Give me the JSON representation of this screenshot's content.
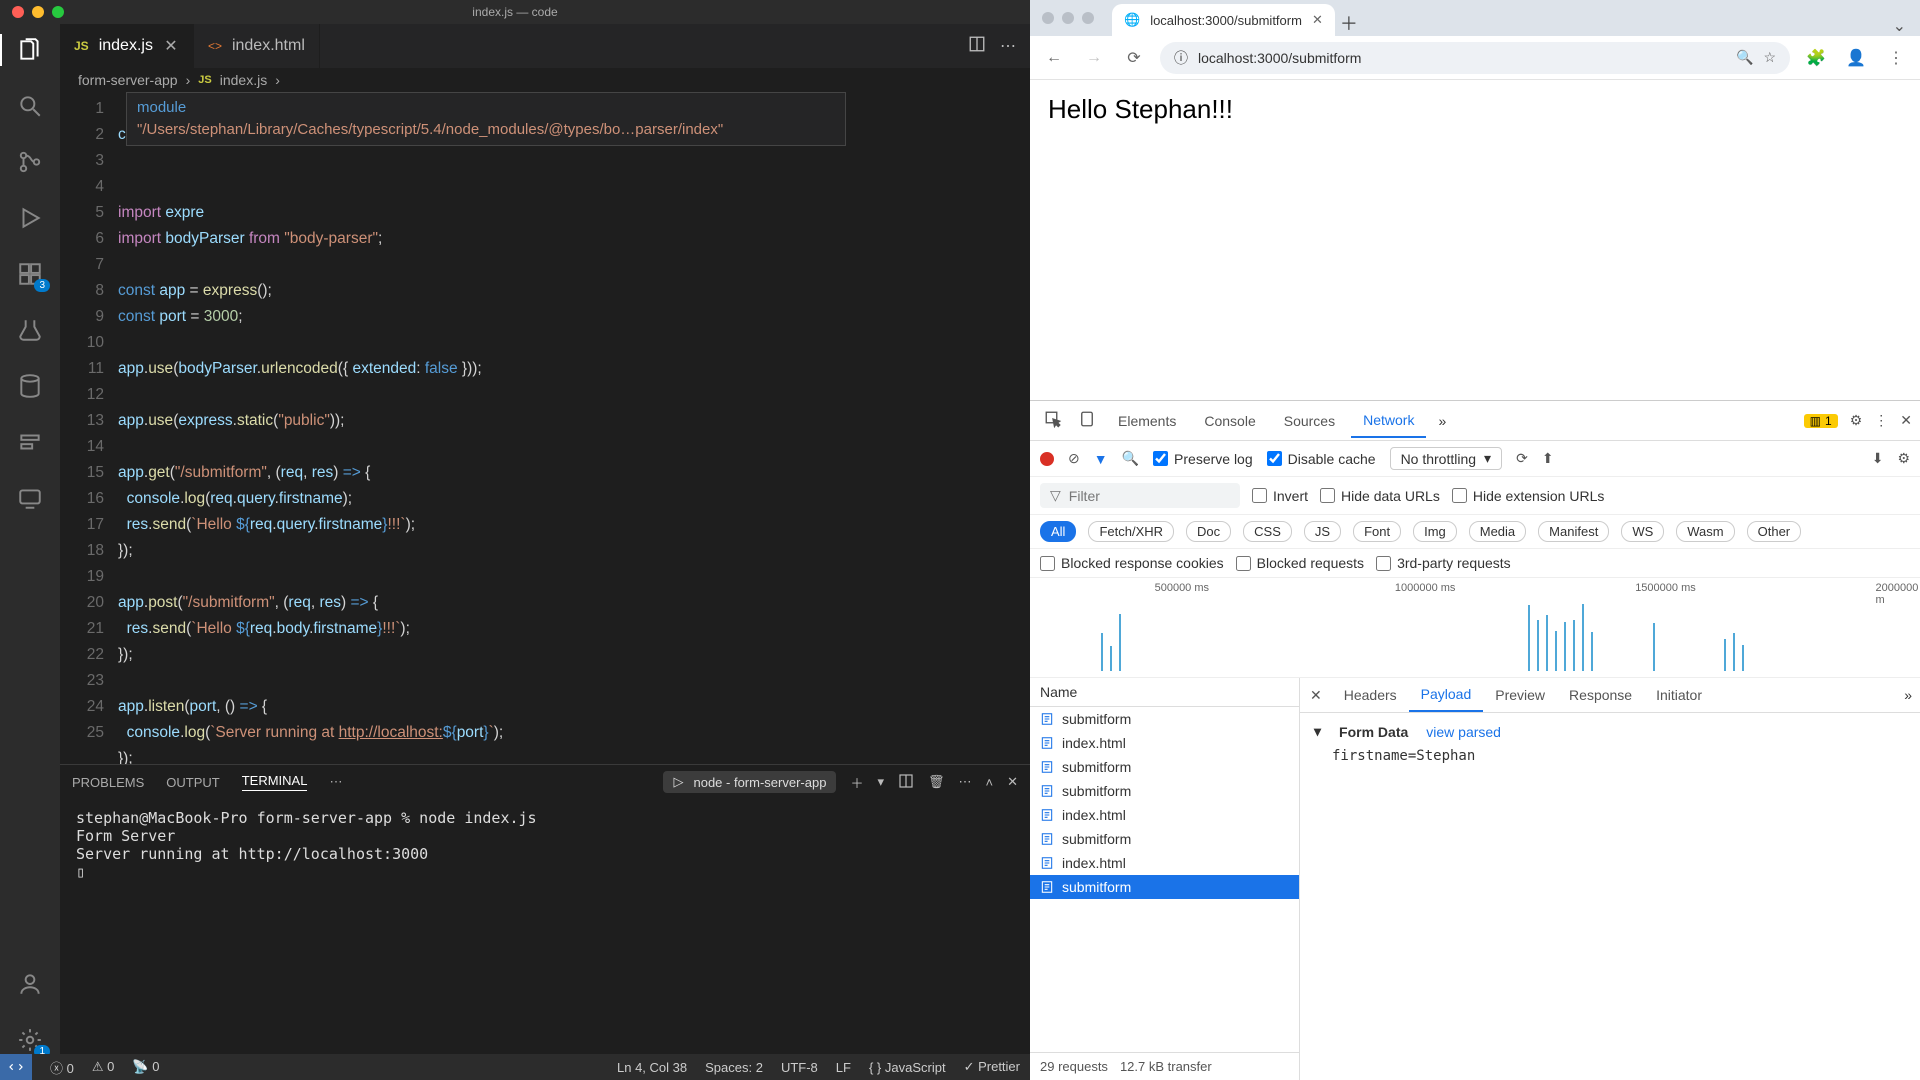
{
  "vscode": {
    "title": "index.js — code",
    "tabs": [
      {
        "icon": "JS",
        "label": "index.js",
        "active": true,
        "dirty": false
      },
      {
        "icon": "<>",
        "label": "index.html",
        "active": false
      }
    ],
    "breadcrumb": {
      "folder": "form-server-app",
      "icon": "JS",
      "file": "index.js"
    },
    "tooltip": {
      "kind": "module",
      "path": "\"/Users/stephan/Library/Caches/typescript/5.4/node_modules/@types/bo…parser/index\""
    },
    "code_lines": [
      "console.log(",
      "",
      "import expre",
      "import bodyParser from \"body-parser\";",
      "",
      "const app = express();",
      "const port = 3000;",
      "",
      "app.use(bodyParser.urlencoded({ extended: false }));",
      "",
      "app.use(express.static(\"public\"));",
      "",
      "app.get(\"/submitform\", (req, res) => {",
      "  console.log(req.query.firstname);",
      "  res.send(`Hello ${req.query.firstname}!!!`);",
      "});",
      "",
      "app.post(\"/submitform\", (req, res) => {",
      "  res.send(`Hello ${req.body.firstname}!!!`);",
      "});",
      "",
      "app.listen(port, () => {",
      "  console.log(`Server running at http://localhost:${port}`);",
      "});",
      ""
    ],
    "terminal": {
      "tabs": [
        "PROBLEMS",
        "OUTPUT",
        "TERMINAL"
      ],
      "active": "TERMINAL",
      "task": "node - form-server-app",
      "lines": [
        "stephan@MacBook-Pro form-server-app % node index.js",
        "Form Server",
        "Server running at http://localhost:3000",
        "▯"
      ]
    },
    "status": {
      "errors": "0",
      "warnings": "0",
      "ports": "0",
      "cursor": "Ln 4, Col 38",
      "spaces": "Spaces: 2",
      "encoding": "UTF-8",
      "eol": "LF",
      "lang": "JavaScript",
      "prettier": "Prettier"
    },
    "badges": {
      "explorer": "3",
      "settings": "1"
    }
  },
  "chrome": {
    "tab_title": "localhost:3000/submitform",
    "url": "localhost:3000/submitform",
    "page_text": "Hello Stephan!!!",
    "devtools": {
      "tabs": [
        "Elements",
        "Console",
        "Sources",
        "Network"
      ],
      "active": "Network",
      "issues": "1",
      "preserve_log": "Preserve log",
      "disable_cache": "Disable cache",
      "throttling": "No throttling",
      "filter_placeholder": "Filter",
      "invert": "Invert",
      "hide_data": "Hide data URLs",
      "hide_ext": "Hide extension URLs",
      "types": [
        "All",
        "Fetch/XHR",
        "Doc",
        "CSS",
        "JS",
        "Font",
        "Img",
        "Media",
        "Manifest",
        "WS",
        "Wasm",
        "Other"
      ],
      "blocked_cookies": "Blocked response cookies",
      "blocked_req": "Blocked requests",
      "third_party": "3rd-party requests",
      "time_labels": [
        "500000 ms",
        "1000000 ms",
        "1500000 ms",
        "2000000 m"
      ],
      "req_header": "Name",
      "requests": [
        {
          "name": "submitform",
          "type": "doc"
        },
        {
          "name": "index.html",
          "type": "doc"
        },
        {
          "name": "submitform",
          "type": "doc"
        },
        {
          "name": "submitform",
          "type": "doc"
        },
        {
          "name": "index.html",
          "type": "doc"
        },
        {
          "name": "submitform",
          "type": "doc"
        },
        {
          "name": "index.html",
          "type": "doc"
        },
        {
          "name": "submitform",
          "type": "doc",
          "selected": true
        }
      ],
      "footer": {
        "count": "29 requests",
        "size": "12.7 kB transfer"
      },
      "detail_tabs": [
        "Headers",
        "Payload",
        "Preview",
        "Response",
        "Initiator"
      ],
      "detail_active": "Payload",
      "form_data_title": "Form Data",
      "view_parsed": "view parsed",
      "form_data": "firstname=Stephan"
    }
  }
}
